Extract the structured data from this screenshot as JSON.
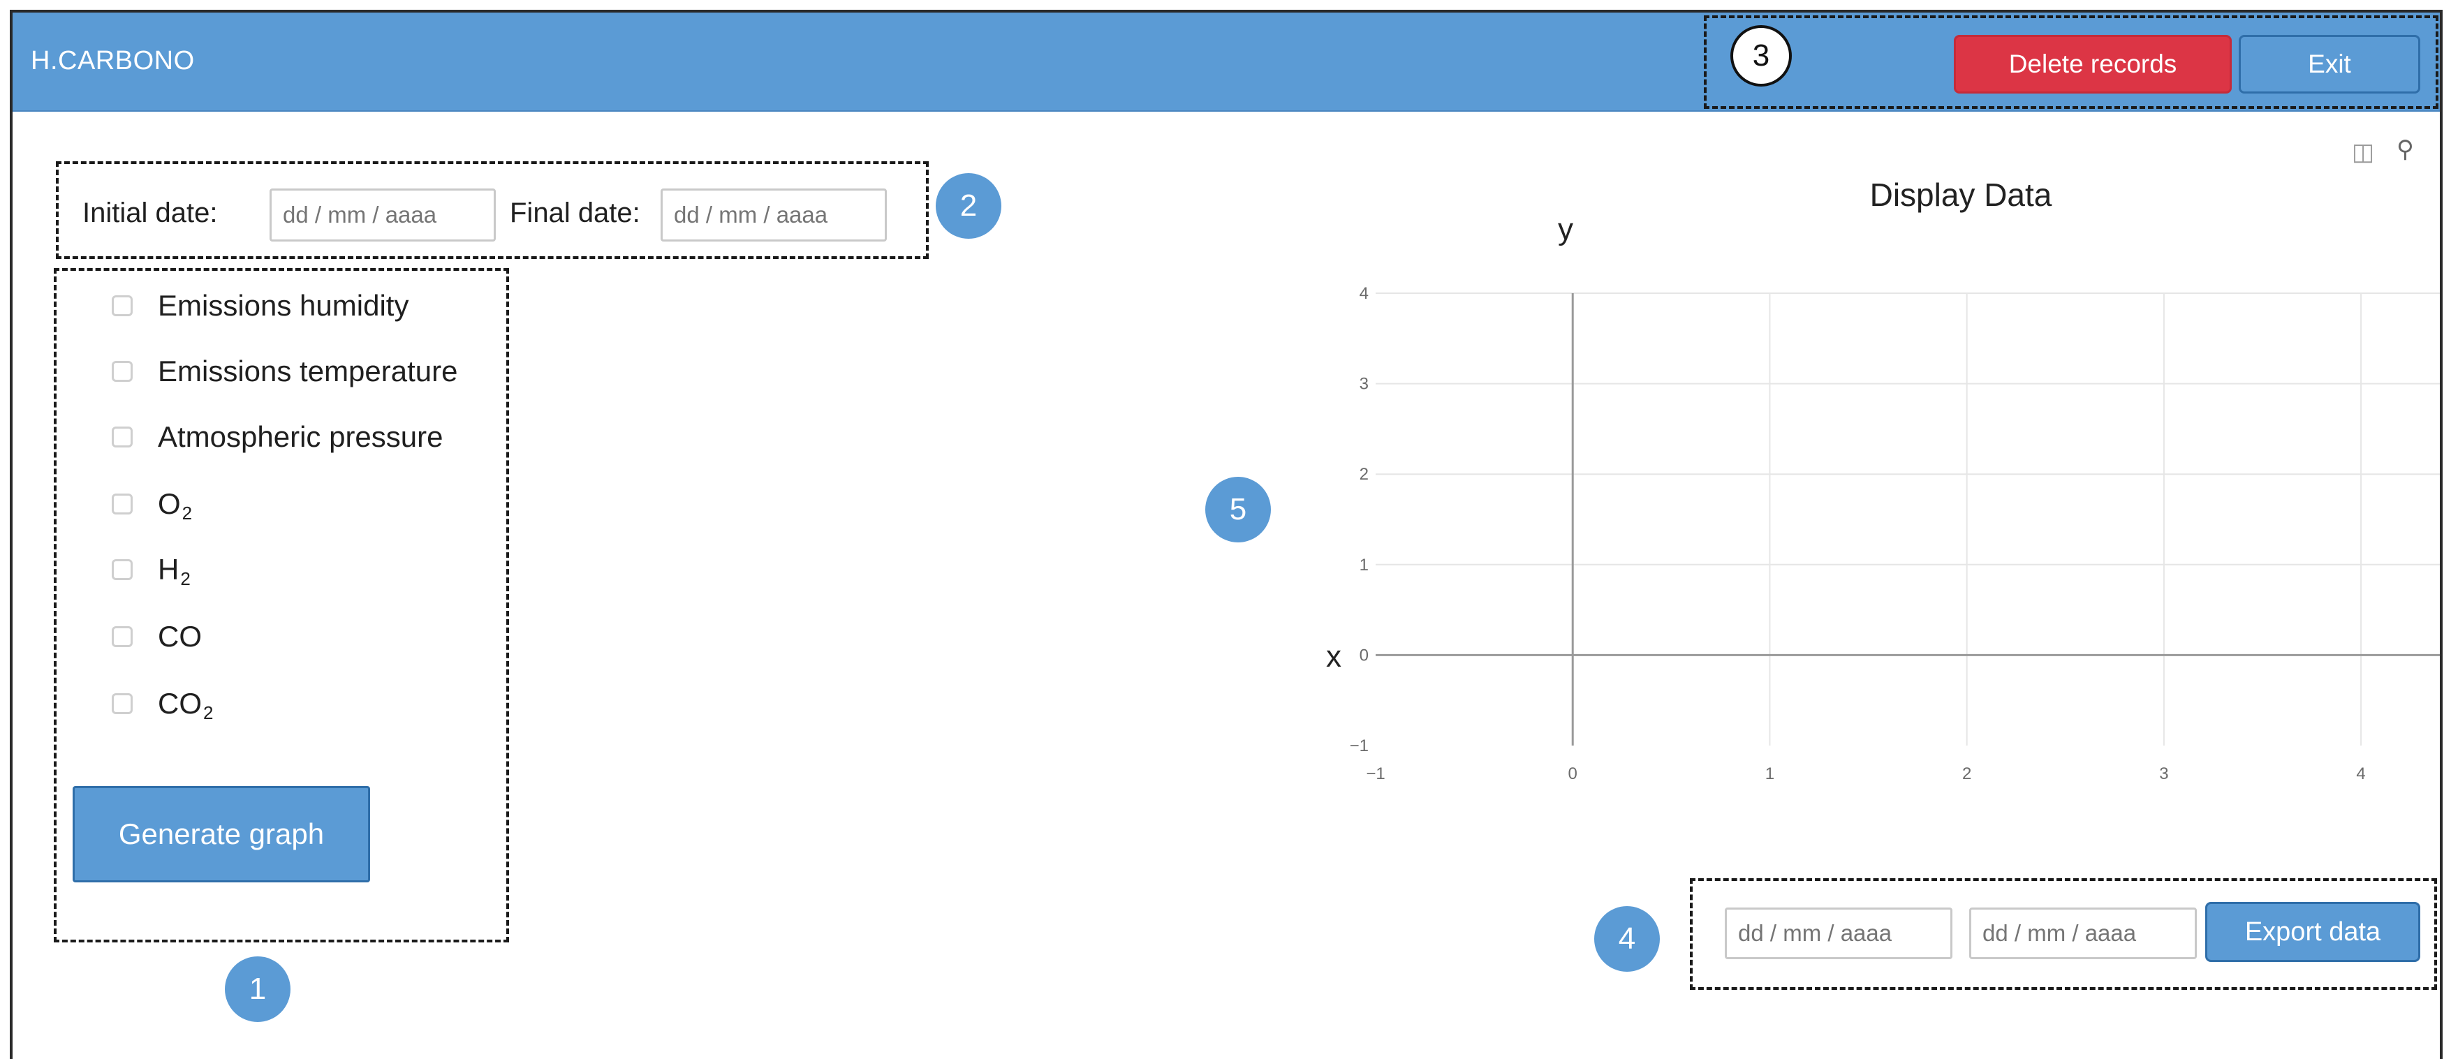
{
  "app": {
    "title": "H.CARBONO"
  },
  "header": {
    "delete_label": "Delete records",
    "exit_label": "Exit"
  },
  "markers": {
    "m1": "1",
    "m2": "2",
    "m3": "3",
    "m4": "4",
    "m5": "5"
  },
  "date_filter": {
    "initial_label": "Initial date:",
    "initial_placeholder": "dd / mm / aaaa",
    "final_label": "Final date:",
    "final_placeholder": "dd / mm / aaaa"
  },
  "variables": [
    {
      "label": "Emissions humidity",
      "base": "",
      "sub": ""
    },
    {
      "label": "Emissions temperature",
      "base": "",
      "sub": ""
    },
    {
      "label": "Atmospheric pressure",
      "base": "",
      "sub": ""
    },
    {
      "label": "",
      "base": "O",
      "sub": "2"
    },
    {
      "label": "",
      "base": "H",
      "sub": "2"
    },
    {
      "label": "CO",
      "base": "",
      "sub": ""
    },
    {
      "label": "",
      "base": "CO",
      "sub": "2"
    }
  ],
  "generate_label": "Generate graph",
  "export": {
    "from_placeholder": "dd / mm / aaaa",
    "to_placeholder": "dd / mm / aaaa",
    "button_label": "Export data"
  },
  "toolbar_icons": [
    "camera-icon",
    "zoom-icon"
  ],
  "colors": {
    "header": "#5b9bd5",
    "accent_blue": "#5b9bd5",
    "danger": "#dc3545"
  },
  "chart_data": {
    "type": "line",
    "title": "Display Data",
    "xlabel": "x",
    "ylabel": "y",
    "xlim": [
      -1,
      4.4
    ],
    "ylim": [
      -1,
      4
    ],
    "x_ticks": [
      "−1",
      "0",
      "1",
      "2",
      "3",
      "4"
    ],
    "y_ticks": [
      "−1",
      "0",
      "1",
      "2",
      "3",
      "4"
    ],
    "grid": true,
    "series": []
  }
}
